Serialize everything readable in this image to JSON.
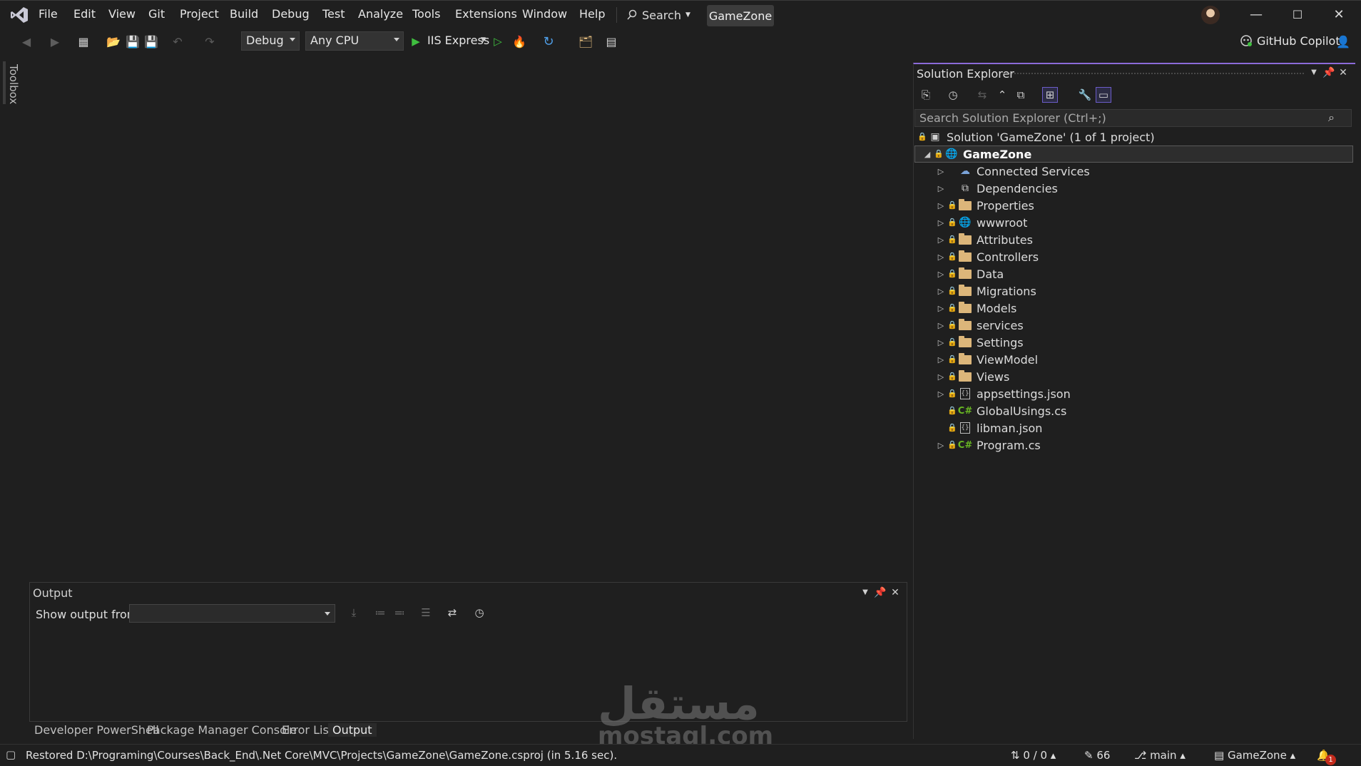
{
  "menu": {
    "items": [
      "File",
      "Edit",
      "View",
      "Git",
      "Project",
      "Build",
      "Debug",
      "Test",
      "Analyze",
      "Tools",
      "Extensions",
      "Window",
      "Help"
    ],
    "search_label": "Search",
    "solution_name": "GameZone"
  },
  "toolbar": {
    "configuration": "Debug",
    "platform": "Any CPU",
    "run_target": "IIS Express",
    "copilot_label": "GitHub Copilot"
  },
  "toolbox": {
    "label": "Toolbox"
  },
  "output_panel": {
    "title": "Output",
    "show_output_label": "Show output from:",
    "show_output_value": ""
  },
  "bottom_tabs": [
    "Developer PowerShell",
    "Package Manager Console",
    "Error List",
    "Output"
  ],
  "solution_explorer": {
    "title": "Solution Explorer",
    "search_placeholder": "Search Solution Explorer (Ctrl+;)",
    "solution_label": "Solution 'GameZone' (1 of 1 project)",
    "project_name": "GameZone",
    "items": [
      {
        "label": "Connected Services",
        "icon": "connected-services-icon",
        "expandable": true,
        "locked": false
      },
      {
        "label": "Dependencies",
        "icon": "dependencies-icon",
        "expandable": true,
        "locked": false
      },
      {
        "label": "Properties",
        "icon": "properties-folder-icon",
        "expandable": true,
        "locked": true
      },
      {
        "label": "wwwroot",
        "icon": "globe-icon",
        "expandable": true,
        "locked": true
      },
      {
        "label": "Attributes",
        "icon": "folder-icon",
        "expandable": true,
        "locked": true
      },
      {
        "label": "Controllers",
        "icon": "folder-icon",
        "expandable": true,
        "locked": true
      },
      {
        "label": "Data",
        "icon": "folder-icon",
        "expandable": true,
        "locked": true
      },
      {
        "label": "Migrations",
        "icon": "folder-icon",
        "expandable": true,
        "locked": true
      },
      {
        "label": "Models",
        "icon": "folder-icon",
        "expandable": true,
        "locked": true
      },
      {
        "label": "services",
        "icon": "folder-icon",
        "expandable": true,
        "locked": true
      },
      {
        "label": "Settings",
        "icon": "folder-icon",
        "expandable": true,
        "locked": true
      },
      {
        "label": "ViewModel",
        "icon": "folder-icon",
        "expandable": true,
        "locked": true
      },
      {
        "label": "Views",
        "icon": "folder-icon",
        "expandable": true,
        "locked": true
      },
      {
        "label": "appsettings.json",
        "icon": "json-file-icon",
        "expandable": true,
        "locked": true
      },
      {
        "label": "GlobalUsings.cs",
        "icon": "csharp-file-icon",
        "expandable": false,
        "locked": true
      },
      {
        "label": "libman.json",
        "icon": "json-file-icon",
        "expandable": false,
        "locked": true
      },
      {
        "label": "Program.cs",
        "icon": "csharp-file-icon",
        "expandable": true,
        "locked": true
      }
    ]
  },
  "watermark": {
    "arabic": "مستقل",
    "latin": "mostaql.com"
  },
  "status_bar": {
    "message": "Restored D:\\Programing\\Courses\\Back_End\\.Net Core\\MVC\\Projects\\GameZone\\GameZone.csproj (in 5.16 sec).",
    "changes": "0 / 0",
    "edits": "66",
    "branch": "main",
    "repo": "GameZone",
    "notifications": "1"
  },
  "colors": {
    "accent": "#8c6bd9",
    "run_green": "#3fbf3f",
    "folder": "#dcb67a",
    "csharp": "#68b723"
  }
}
